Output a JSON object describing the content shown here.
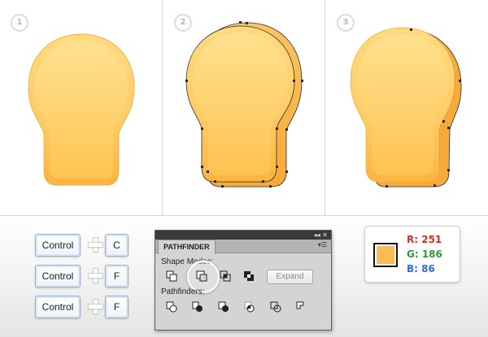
{
  "steps": [
    {
      "number": "1"
    },
    {
      "number": "2"
    },
    {
      "number": "3"
    }
  ],
  "shortcuts": [
    {
      "modifier": "Control",
      "key": "C"
    },
    {
      "modifier": "Control",
      "key": "F"
    },
    {
      "modifier": "Control",
      "key": "F"
    }
  ],
  "pathfinder": {
    "tab_label": "PATHFINDER",
    "window_controls": "◂◂ ✕",
    "menu_glyph": "▾☰",
    "shape_modes_label": "Shape Modes:",
    "expand_label": "Expand",
    "pathfinders_label": "Pathfinders:",
    "shape_mode_icons": [
      "unite-icon",
      "minus-front-icon",
      "intersect-icon",
      "exclude-icon"
    ],
    "pathfinder_icons": [
      "divide-icon",
      "trim-icon",
      "merge-icon",
      "crop-icon",
      "outline-icon",
      "minus-back-icon"
    ]
  },
  "color": {
    "swatch_hex": "#FBBA56",
    "r_label": "R: 251",
    "g_label": "G: 186",
    "b_label": "B: 86",
    "r_color": "#d42b2b",
    "g_color": "#2e9b3b",
    "b_color": "#2b6fd0"
  },
  "bulb_colors": {
    "fill_top": "#FFD97B",
    "fill_bottom": "#FBB43F",
    "outline": "#E9A536",
    "selection": "#2b2b2b"
  }
}
